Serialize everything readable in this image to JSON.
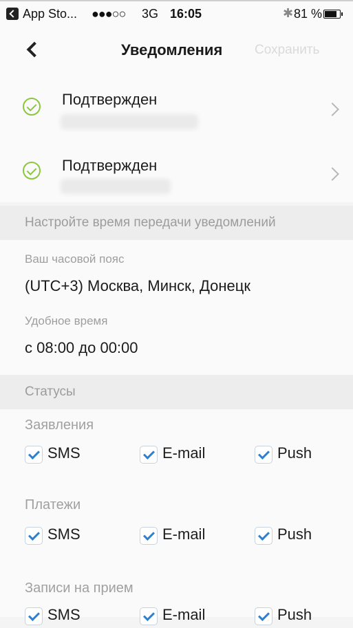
{
  "status_bar": {
    "back_app": "App Sto...",
    "signal": "●●●○○",
    "network": "3G",
    "time": "16:05",
    "bluetooth_icon": "bluetooth-icon",
    "battery": "81 %",
    "battery_level": 0.81
  },
  "nav": {
    "back_icon": "chevron-left-icon",
    "title": "Уведомления",
    "save_label": "Сохранить"
  },
  "confirmations": [
    {
      "label": "Подтвержден",
      "icon": "check-circle-icon"
    },
    {
      "label": "Подтвержден",
      "icon": "check-circle-icon"
    }
  ],
  "timing_section": {
    "header": "Настройте время передачи уведомлений",
    "timezone_label": "Ваш часовой пояс",
    "timezone_value": "(UTC+3) Москва, Минск, Донецк",
    "time_label": "Удобное время",
    "time_value": "с 08:00 до 00:00"
  },
  "statuses_section": {
    "header": "Статусы",
    "groups": [
      {
        "title": "Заявления",
        "options": [
          {
            "label": "SMS",
            "checked": true
          },
          {
            "label": "E-mail",
            "checked": true
          },
          {
            "label": "Push",
            "checked": true
          }
        ]
      },
      {
        "title": "Платежи",
        "options": [
          {
            "label": "SMS",
            "checked": true
          },
          {
            "label": "E-mail",
            "checked": true
          },
          {
            "label": "Push",
            "checked": true
          }
        ]
      },
      {
        "title": "Записи на прием",
        "options": [
          {
            "label": "SMS",
            "checked": true
          },
          {
            "label": "E-mail",
            "checked": true
          },
          {
            "label": "Push",
            "checked": true
          }
        ]
      }
    ]
  },
  "colors": {
    "accent_check": "#2f7fd0",
    "confirmed_green": "#8cc63f",
    "muted_text": "#9e9e9e"
  }
}
